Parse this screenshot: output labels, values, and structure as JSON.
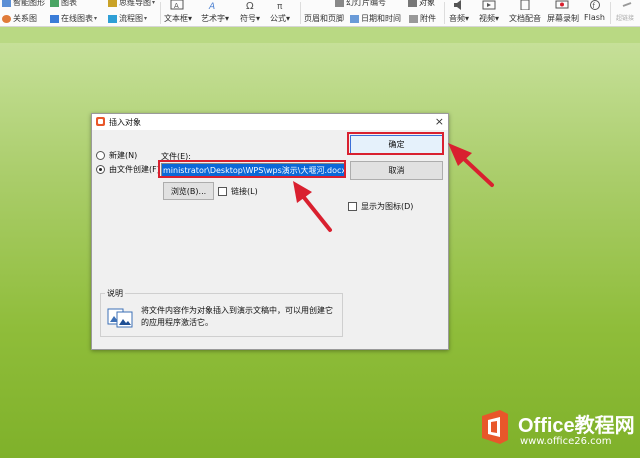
{
  "ribbon": {
    "row1": [
      {
        "label": "智能图形"
      },
      {
        "label": "图表"
      },
      {
        "label": "思维导图"
      },
      {
        "label": "幻灯片编号"
      },
      {
        "label": "对象"
      }
    ],
    "row2": [
      {
        "label": "关系图"
      },
      {
        "label": "在线图表"
      },
      {
        "label": "流程图"
      }
    ],
    "big_items": [
      {
        "label": "文本框",
        "icon": "textbox-icon"
      },
      {
        "label": "艺术字",
        "icon": "wordart-icon"
      },
      {
        "label": "符号",
        "icon": "omega-icon"
      },
      {
        "label": "公式",
        "icon": "formula-icon"
      },
      {
        "label": "页眉和页脚",
        "icon": "header-footer-icon"
      },
      {
        "label": "日期和时间",
        "icon": "date-time-icon"
      },
      {
        "label": "附件",
        "icon": "attachment-icon"
      },
      {
        "label": "音频",
        "icon": "audio-icon"
      },
      {
        "label": "视频",
        "icon": "video-icon"
      },
      {
        "label": "文档配音",
        "icon": "dub-icon"
      },
      {
        "label": "屏幕录制",
        "icon": "screen-record-icon"
      },
      {
        "label": "Flash",
        "icon": "flash-icon"
      },
      {
        "label": "超链接",
        "icon": "hyperlink-icon"
      }
    ]
  },
  "dialog": {
    "title": "插入对象",
    "close": "×",
    "radio_new": "新建(N)",
    "radio_from_file": "由文件创建(F)",
    "file_label": "文件(E):",
    "file_value": "ministrator\\Desktop\\WPS\\wps演示\\大堰河.docx",
    "ok": "确定",
    "cancel": "取消",
    "browse": "浏览(B)...",
    "link": "链接(L)",
    "show_as_icon": "显示为图标(D)",
    "desc_legend": "说明",
    "desc_text": "将文件内容作为对象插入到演示文稿中，可以用创建它的应用程序激活它。"
  },
  "watermark": {
    "title": "Office教程网",
    "url": "www.office26.com"
  },
  "colors": {
    "highlight_red": "#d9202f",
    "selection_blue": "#0b68d8",
    "slide_green": "#8fbd3a",
    "logo_orange": "#e8572a"
  }
}
